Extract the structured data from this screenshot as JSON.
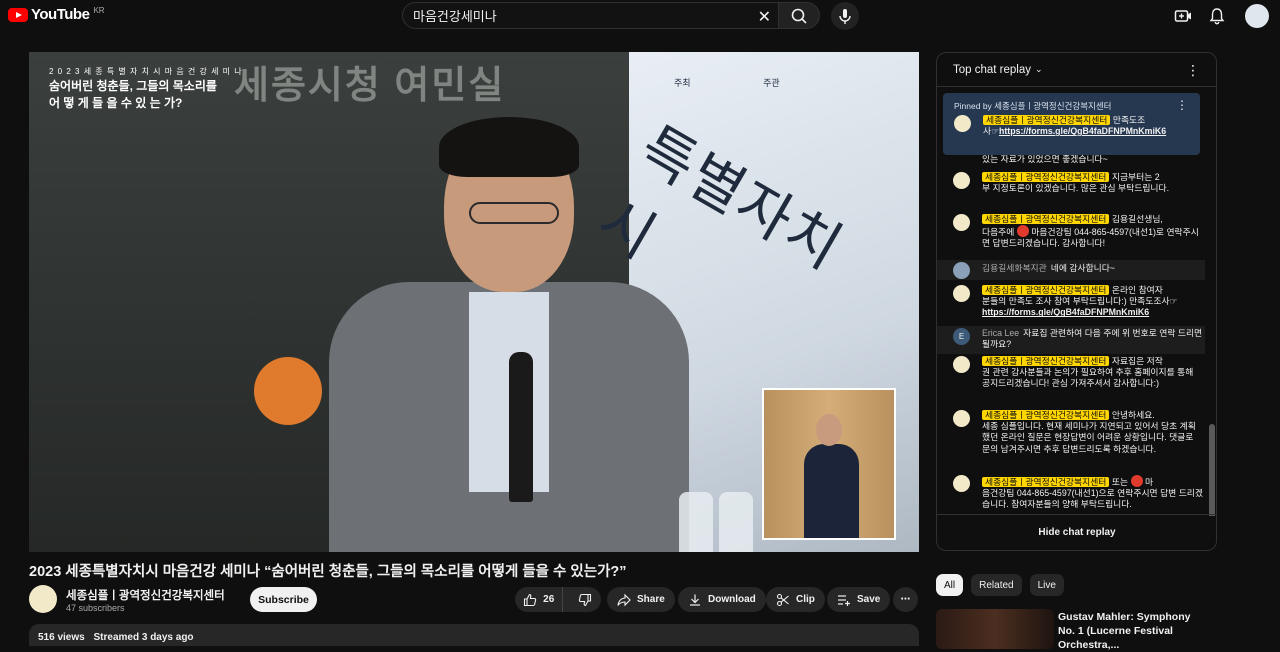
{
  "brand": {
    "name": "YouTube",
    "region": "KR"
  },
  "search": {
    "value": "마음건강세미나"
  },
  "video_overlay": {
    "line1": "2 0 2 3  세 종 특 별 자 치 시  마 음 건 강  세 미 나",
    "line2a": "숨어버린 청춘들, 그들의 목소리를",
    "line2b": "어 떻 게   들 을   수   있 는 가?",
    "wall_text": "세종시청 여민실",
    "flag_text": "특별자치시",
    "org_left": "주최",
    "org_mid": "주관"
  },
  "video": {
    "title": "2023 세종특별자치시 마음건강 세미나 “숨어버린 청춘들, 그들의 목소리를 어떻게 들을 수 있는가?”",
    "channel": "세종심플ㅣ광역정신건강복지센터",
    "subscribers": "47 subscribers",
    "subscribe_label": "Subscribe",
    "likes": "26",
    "share_label": "Share",
    "download_label": "Download",
    "clip_label": "Clip",
    "save_label": "Save",
    "views": "516 views",
    "streamed": "Streamed 3 days ago"
  },
  "chat": {
    "header": "Top chat replay",
    "pinned_by": "Pinned by 세종심플ㅣ광역정신건강복지센터",
    "author_chip": "세종심플ㅣ광역정신건강복지센터",
    "pinned_text": "만족도조",
    "pinned_text2": "사☞",
    "pinned_link": "https://forms.gle/QgB4faDFNPMnKmiK6",
    "m0_partial": "있는 자료가 있었으면 좋겠습니다~",
    "m1_text": "지금부터는 2",
    "m1_text2": "부 지정토론이 있겠습니다. 많은 관심 부탁드립니다.",
    "m2_text": "김용길선생님,",
    "m2_text2a": "다음주에",
    "m2_text2b": "마음건강팀 044-865-4597(내선1)로 연락주시면 답변드리겠습니다. 감사합니다!",
    "m3_author": "김용길세화복지관",
    "m3_text": "네에 감사합니다~",
    "m4_text": "온라인 참여자",
    "m4_text2": "분들의 만족도 조사 참여 부탁드립니다:) 만족도조사☞",
    "m4_link": "https://forms.gle/QgB4faDFNPMnKmiK6",
    "m5_author": "Erica Lee",
    "m5_initial": "E",
    "m5_text": "자료집 관련하여 다음 주에 위 번호로 연락 드리면 될까요?",
    "m6_text": "자료집은 저작",
    "m6_text2": "권 관련 감사분들과 논의가 필요하여 추후 홈페이지를 통해 공지드리겠습니다! 관심 가져주셔서 감사합니다:)",
    "m7_text": "안녕하세요.",
    "m7_text2": "세종 심플입니다. 현재 세미나가 지연되고 있어서 당초 계획했던 온라인 질문은 현장답변이 어려운 상황입니다. 댓글로 문의 남겨주시면 추후 답변드리도록 하겠습니다.",
    "m8_text_a": "또는",
    "m8_text_b": "마",
    "m8_text2": "음건강팀 044-865-4597(내선1)으로 연락주시면 답변 드리겠습니다. 참여자분들의 양해 부탁드립니다.",
    "footer": "Hide chat replay"
  },
  "filters": [
    "All",
    "Related",
    "Live"
  ],
  "recommendation": {
    "title": "Gustav Mahler: Symphony No. 1 (Lucerne Festival Orchestra,..."
  },
  "colors": {
    "accent": "#ff0000",
    "chip": "#ffd600",
    "pinned_bg": "#263850"
  }
}
